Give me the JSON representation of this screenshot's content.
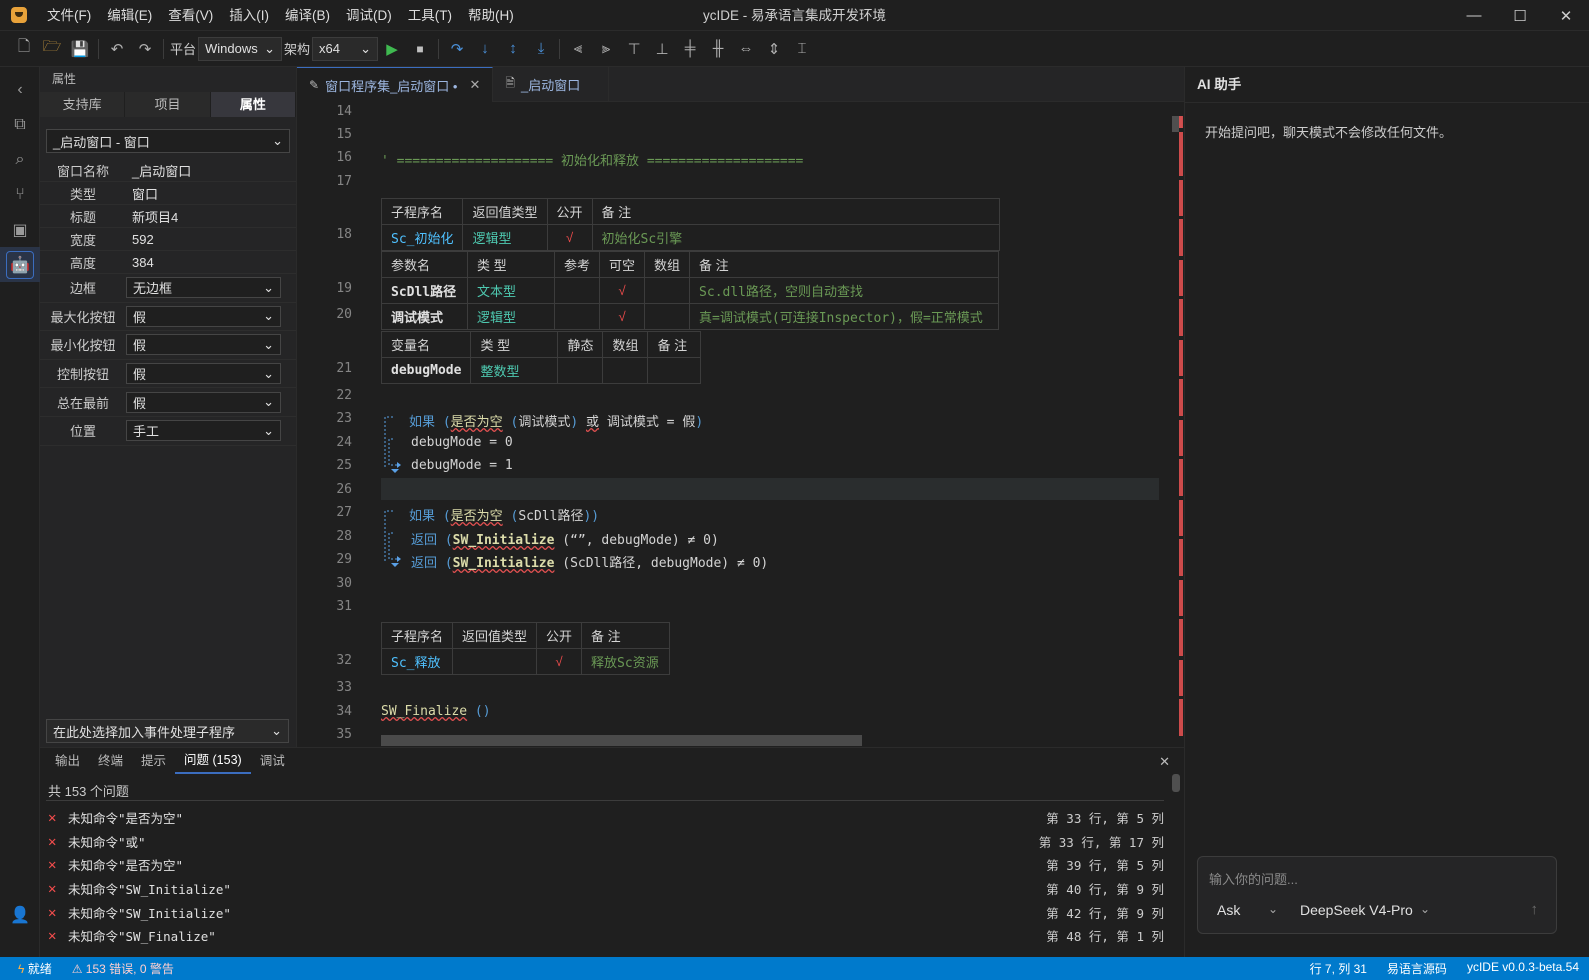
{
  "window": {
    "title": "ycIDE - 易承语言集成开发环境"
  },
  "menu": [
    "文件(F)",
    "编辑(E)",
    "查看(V)",
    "插入(I)",
    "编译(B)",
    "调试(D)",
    "工具(T)",
    "帮助(H)"
  ],
  "toolbar": {
    "platform_label": "平台",
    "platform_value": "Windows",
    "arch_label": "架构",
    "arch_value": "x64"
  },
  "left_panel": {
    "header": "属性",
    "tabs": [
      "支持库",
      "项目",
      "属性"
    ],
    "active_tab": "属性",
    "object_select": "_启动窗口 - 窗口",
    "props": [
      {
        "k": "窗口名称",
        "v": "_启动窗口"
      },
      {
        "k": "类型",
        "v": "窗口"
      },
      {
        "k": "标题",
        "v": "新项目4"
      },
      {
        "k": "宽度",
        "v": "592"
      },
      {
        "k": "高度",
        "v": "384"
      }
    ],
    "select_props": [
      {
        "k": "边框",
        "v": "无边框"
      },
      {
        "k": "最大化按钮",
        "v": "假"
      },
      {
        "k": "最小化按钮",
        "v": "假"
      },
      {
        "k": "控制按钮",
        "v": "假"
      },
      {
        "k": "总在最前",
        "v": "假"
      },
      {
        "k": "位置",
        "v": "手工"
      }
    ],
    "event_select": "在此处选择加入事件处理子程序"
  },
  "editor_tabs": [
    {
      "label": "窗口程序集_启动窗口 •",
      "active": true
    },
    {
      "label": "_启动窗口",
      "active": false
    }
  ],
  "editor": {
    "line_numbers": [
      "14",
      "15",
      "16",
      "17",
      "18",
      "19",
      "20",
      "21",
      "22",
      "23",
      "24",
      "25",
      "26",
      "27",
      "28",
      "29",
      "30",
      "31",
      "32",
      "33",
      "34",
      "35"
    ],
    "comment_line": "' ==================== 初始化和释放 ====================",
    "table1_head": [
      "子程序名",
      "返回值类型",
      "公开",
      "备 注"
    ],
    "table1_row": [
      "Sc_初始化",
      "逻辑型",
      "√",
      "初始化Sc引擎"
    ],
    "param_head": [
      "参数名",
      "类 型",
      "参考",
      "可空",
      "数组",
      "备 注"
    ],
    "params": [
      [
        "ScDll路径",
        "文本型",
        "",
        "√",
        "",
        "Sc.dll路径，空则自动查找"
      ],
      [
        "调试模式",
        "逻辑型",
        "",
        "√",
        "",
        "真=调试模式(可连接Inspector)，假=正常模式"
      ]
    ],
    "var_head": [
      "变量名",
      "类 型",
      "静态",
      "数组",
      "备 注"
    ],
    "vars": [
      [
        "debugMode",
        "整数型",
        "",
        "",
        ""
      ]
    ],
    "code": {
      "if1_kw": "如果",
      "if1_a": "是否为空",
      "if1_b": "调试模式",
      "if1_or": "或",
      "if1_c": "调试模式 = 假",
      "l24": "debugMode = 0",
      "l25": "debugMode = 1",
      "if2_kw": "如果",
      "if2_a": "是否为空",
      "if2_b": "ScDll路径",
      "ret": "返回",
      "swi": "SW_Initialize",
      "l28_args": "(“”, debugMode) ≠ 0)",
      "l29_args": "(ScDll路径, debugMode) ≠ 0)",
      "swf": "SW_Finalize",
      "swf_args": "()"
    },
    "table2_head": [
      "子程序名",
      "返回值类型",
      "公开",
      "备 注"
    ],
    "table2_row": [
      "Sc_释放",
      "",
      "√",
      "释放Sc资源"
    ]
  },
  "ai_panel": {
    "title": "AI 助手",
    "hint": "开始提问吧，聊天模式不会修改任何文件。",
    "input_placeholder": "输入你的问题...",
    "mode": "Ask",
    "model": "DeepSeek V4-Pro"
  },
  "bottom_panel": {
    "tabs": [
      "输出",
      "终端",
      "提示",
      "问题 (153)",
      "调试"
    ],
    "active_tab": "问题 (153)",
    "count_text": "共 153 个问题",
    "problems": [
      {
        "msg": "未知命令\"是否为空\"",
        "loc": "第 33 行, 第 5 列"
      },
      {
        "msg": "未知命令\"或\"",
        "loc": "第 33 行, 第 17 列"
      },
      {
        "msg": "未知命令\"是否为空\"",
        "loc": "第 39 行, 第 5 列"
      },
      {
        "msg": "未知命令\"SW_Initialize\"",
        "loc": "第 40 行, 第 9 列"
      },
      {
        "msg": "未知命令\"SW_Initialize\"",
        "loc": "第 42 行, 第 9 列"
      },
      {
        "msg": "未知命令\"SW_Finalize\"",
        "loc": "第 48 行, 第 1 列"
      }
    ]
  },
  "status": {
    "ready": "就绪",
    "errors": "153 错误, 0 警告",
    "cursor": "行 7, 列 31",
    "lang": "易语言源码",
    "version": "ycIDE v0.0.3-beta.54"
  },
  "colors": {
    "accent": "#007acc",
    "error": "#f14c4c",
    "keyword": "#569cd6",
    "comment": "#6a9955"
  }
}
